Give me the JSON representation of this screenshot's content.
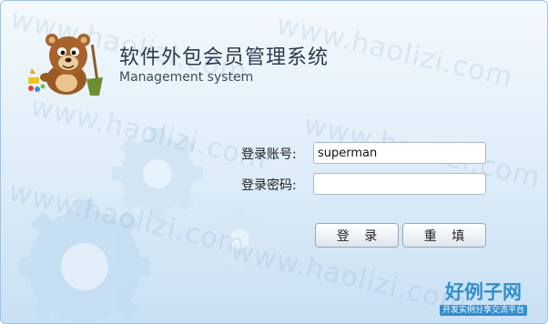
{
  "app": {
    "title": "软件外包会员管理系统",
    "subtitle": "Management system"
  },
  "watermark": {
    "text": "www.haolizi.com"
  },
  "form": {
    "account_label": "登录账号:",
    "account_value": "superman",
    "password_label": "登录密码:",
    "password_value": ""
  },
  "buttons": {
    "login_label": "登 录",
    "reset_label": "重 填"
  },
  "logo": {
    "main": "好例子网",
    "sub": "开发实例分享交流平台"
  },
  "colors": {
    "background": "#dcebf7",
    "accent": "#2f8fd1"
  },
  "icons": [
    "gear-icon",
    "mascot-bear-icon"
  ]
}
